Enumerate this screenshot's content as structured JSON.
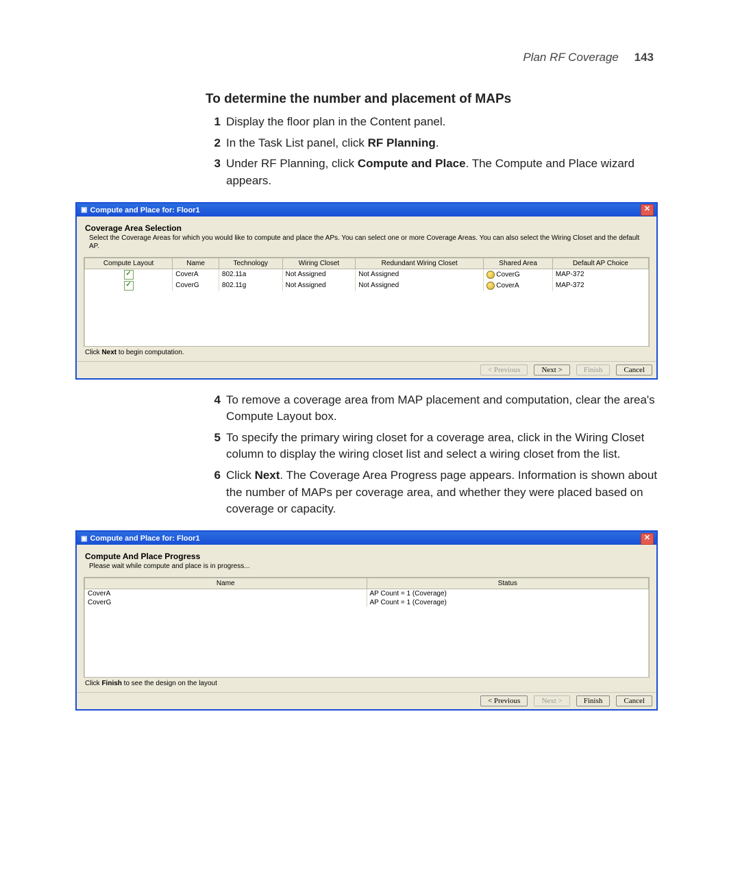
{
  "header": {
    "title": "Plan RF Coverage",
    "page": "143"
  },
  "section_title": "To determine the number and placement of MAPs",
  "steps_top": [
    {
      "n": "1",
      "html": "Display the floor plan in the Content panel."
    },
    {
      "n": "2",
      "html": "In the Task List panel, click <b>RF Planning</b>."
    },
    {
      "n": "3",
      "html": "Under RF Planning, click <b>Compute and Place</b>. The Compute and Place wizard appears."
    }
  ],
  "wizard1": {
    "title": "Compute and Place for: Floor1",
    "close": "✕",
    "heading": "Coverage Area Selection",
    "desc": "Select the Coverage Areas for which you would like to compute and place the APs. You can select  one or more Coverage Areas. You can also select the  Wiring Closet and the default AP.",
    "columns": [
      "Compute Layout",
      "Name",
      "Technology",
      "Wiring Closet",
      "Redundant Wiring Closet",
      "Shared Area",
      "Default AP Choice"
    ],
    "rows": [
      {
        "checked": true,
        "name": "CoverA",
        "tech": "802.11a",
        "wc": "Not Assigned",
        "rwc": "Not Assigned",
        "shared": "CoverG",
        "ap": "MAP-372"
      },
      {
        "checked": true,
        "name": "CoverG",
        "tech": "802.11g",
        "wc": "Not Assigned",
        "rwc": "Not Assigned",
        "shared": "CoverA",
        "ap": "MAP-372"
      }
    ],
    "hint_pre": "Click ",
    "hint_bold": "Next",
    "hint_post": " to begin computation.",
    "btn_prev": "< Previous",
    "btn_next": "Next >",
    "btn_finish": "Finish",
    "btn_cancel": "Cancel"
  },
  "steps_mid": [
    {
      "n": "4",
      "html": "To remove a coverage area from MAP placement and computation, clear the area's Compute Layout box."
    },
    {
      "n": "5",
      "html": "To specify the primary wiring closet for a coverage area, click in the Wiring Closet column to display the wiring closet list and select a wiring closet from the list."
    },
    {
      "n": "6",
      "html": "Click <b>Next</b>. The Coverage Area Progress page appears. Information is shown about the number of MAPs per coverage area, and whether they were placed based on coverage or capacity."
    }
  ],
  "wizard2": {
    "title": "Compute and Place for: Floor1",
    "close": "✕",
    "heading": "Compute And Place Progress",
    "desc": "Please wait while compute and place is in progress...",
    "columns": [
      "Name",
      "Status"
    ],
    "rows": [
      {
        "name": "CoverA",
        "status": "AP Count = 1 (Coverage)"
      },
      {
        "name": "CoverG",
        "status": "AP Count = 1 (Coverage)"
      }
    ],
    "hint_pre": "Click ",
    "hint_bold": "Finish",
    "hint_post": " to see the design on the layout",
    "btn_prev": "< Previous",
    "btn_next": "Next >",
    "btn_finish": "Finish",
    "btn_cancel": "Cancel"
  }
}
